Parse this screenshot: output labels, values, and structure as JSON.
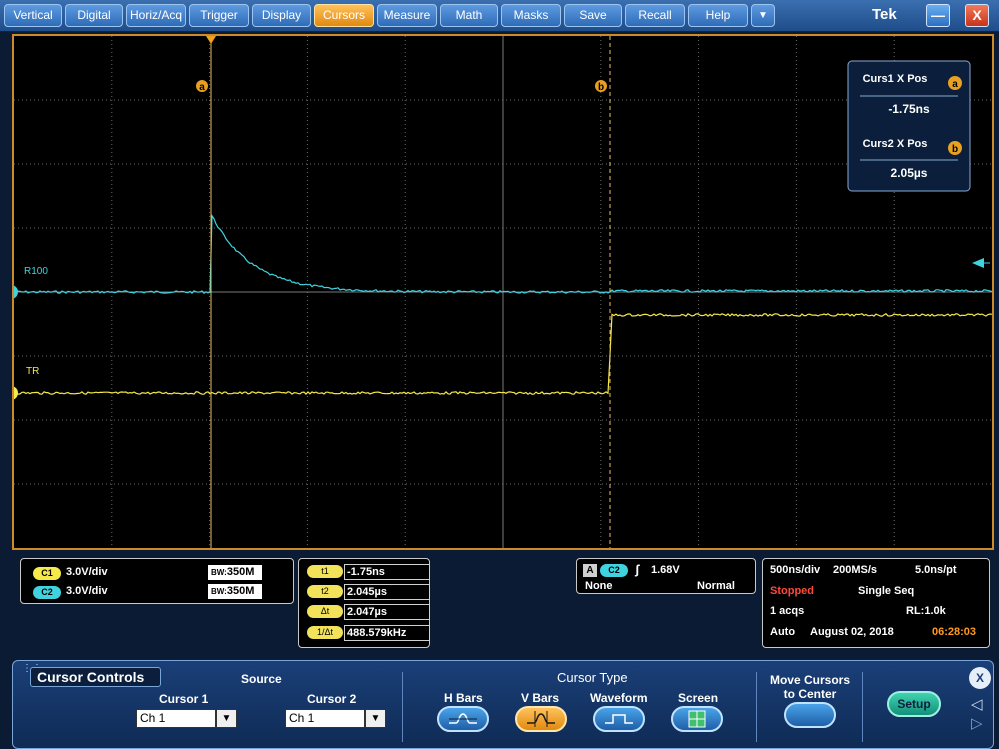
{
  "menu": {
    "items": [
      "Vertical",
      "Digital",
      "Horiz/Acq",
      "Trigger",
      "Display",
      "Cursors",
      "Measure",
      "Math",
      "Masks",
      "Save",
      "Recall",
      "Help"
    ],
    "active": "Cursors",
    "more_glyph": "▼",
    "brand": "Tek",
    "minimize_glyph": "—",
    "close_glyph": "X"
  },
  "graticule": {
    "cursor_a_marker": "a",
    "cursor_b_marker": "b",
    "ch2_label": "R100",
    "ch1_label": "TR",
    "ch2_marker": "2",
    "ch1_marker": "1",
    "ch1_color": "#f5ea4a",
    "ch2_color": "#3fd3e0",
    "cursor_color": "#e8c060"
  },
  "cursor_readout": {
    "curs1_title": "Curs1 X Pos",
    "curs1_value": "-1.75ns",
    "curs2_title": "Curs2 X Pos",
    "curs2_value": "2.05µs",
    "a_badge": "a",
    "b_badge": "b"
  },
  "channels": [
    {
      "tag": "C1",
      "scale": "3.0V/div",
      "bw": "350M",
      "bw_prefix": "BW:",
      "color": "#f5ea4a"
    },
    {
      "tag": "C2",
      "scale": "3.0V/div",
      "bw": "350M",
      "bw_prefix": "BW:",
      "color": "#3fd3e0"
    }
  ],
  "cursor_values": [
    {
      "tag": "t1",
      "value": "-1.75ns"
    },
    {
      "tag": "t2",
      "value": "2.045µs"
    },
    {
      "tag": "Δt",
      "value": "2.047µs"
    },
    {
      "tag": "1/Δt",
      "value": "488.579kHz"
    }
  ],
  "trigger": {
    "mode_letter": "A",
    "source": "C2",
    "slope_glyph": "ʃ",
    "level": "1.68V",
    "coupling": "None",
    "mode": "Normal"
  },
  "acquisition": {
    "horiz_scale": "500ns/div",
    "sample_rate": "200MS/s",
    "resolution": "5.0ns/pt",
    "status": "Stopped",
    "acq_mode": "Single Seq",
    "acq_count": "1 acqs",
    "record_length": "RL:1.0k",
    "trigger_mode": "Auto",
    "date": "August 02, 2018",
    "time": "06:28:03"
  },
  "controls": {
    "title": "Cursor Controls",
    "source_label": "Source",
    "cursor1_label": "Cursor 1",
    "cursor1_value": "Ch 1",
    "cursor2_label": "Cursor 2",
    "cursor2_value": "Ch 1",
    "dropdown_glyph": "▼",
    "cursor_type_label": "Cursor Type",
    "types": [
      "H Bars",
      "V Bars",
      "Waveform",
      "Screen"
    ],
    "selected_type": "V Bars",
    "move_label_1": "Move Cursors",
    "move_label_2": "to Center",
    "setup_label": "Setup",
    "close_glyph": "X",
    "prev_glyph": "◁",
    "next_glyph": "▷"
  }
}
